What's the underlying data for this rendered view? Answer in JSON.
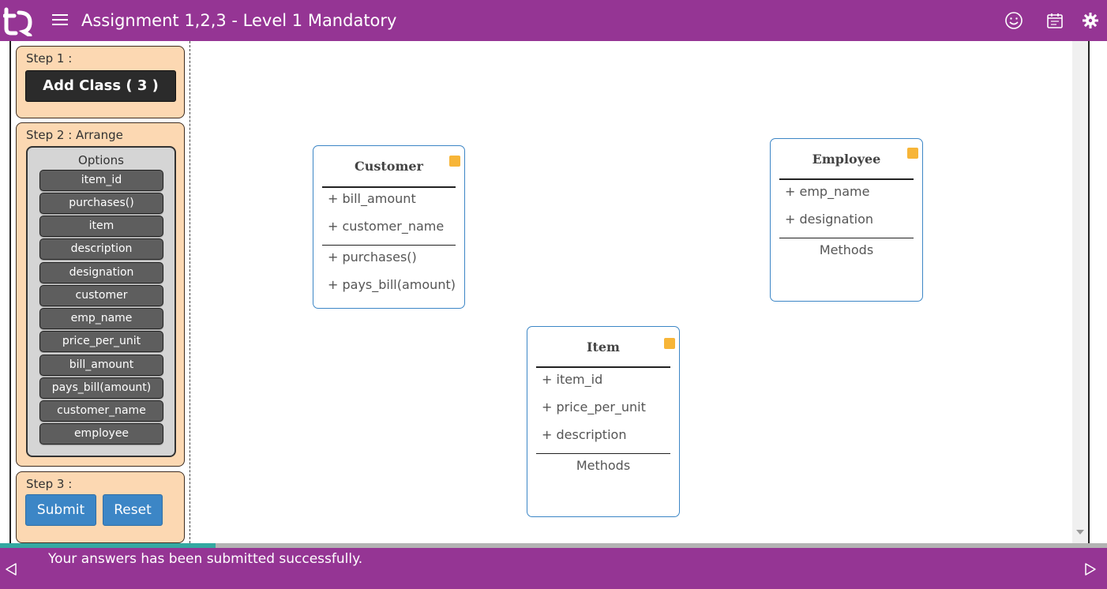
{
  "header": {
    "title": "Assignment 1,2,3 - Level 1 Mandatory",
    "icons": [
      "smiley-icon",
      "calendar-icon",
      "settings-icon"
    ]
  },
  "sidebar": {
    "step1": {
      "label": "Step 1 :",
      "add_class_label": "Add Class ( 3 )"
    },
    "step2": {
      "label": "Step 2 : Arrange",
      "options_title": "Options",
      "options": [
        "item_id",
        "purchases()",
        "item",
        "description",
        "designation",
        "customer",
        "emp_name",
        "price_per_unit",
        "bill_amount",
        "pays_bill(amount)",
        "customer_name",
        "employee"
      ]
    },
    "step3": {
      "label": "Step 3 :",
      "submit_label": "Submit",
      "reset_label": "Reset"
    }
  },
  "classes": {
    "customer": {
      "name": "Customer",
      "attributes": [
        "+ bill_amount",
        "+ customer_name"
      ],
      "methods": [
        "+ purchases()",
        "+ pays_bill(amount)"
      ]
    },
    "employee": {
      "name": "Employee",
      "attributes": [
        "+ emp_name",
        "+ designation"
      ],
      "methods_placeholder": "Methods"
    },
    "item": {
      "name": "Item",
      "attributes": [
        "+ item_id",
        "+ price_per_unit",
        "+ description"
      ],
      "methods_placeholder": "Methods"
    }
  },
  "footer": {
    "message": "Your answers has been submitted successfully.",
    "progress_fraction": 0.195
  },
  "colors": {
    "brand_purple": "#953594",
    "panel_bg": "#fcd8b2",
    "button_blue": "#3c86c6",
    "handle_orange": "#f7b538",
    "progress_teal": "#34a8a1"
  }
}
